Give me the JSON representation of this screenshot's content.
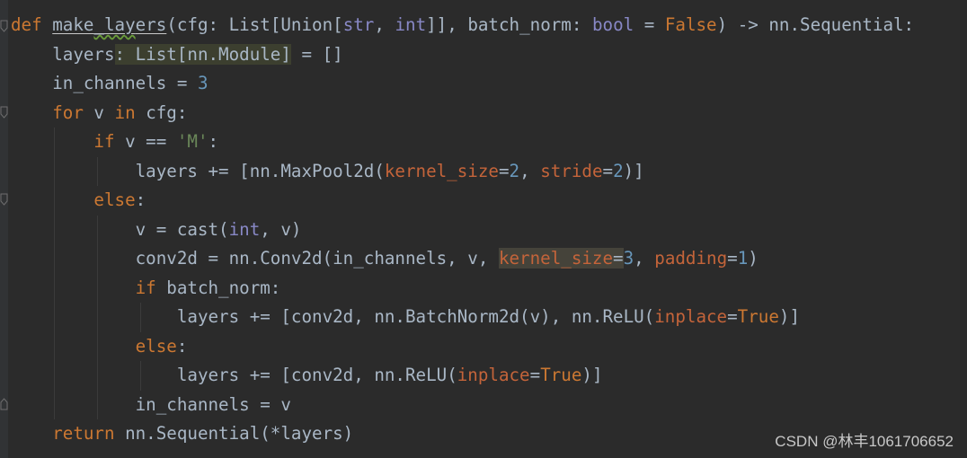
{
  "code": {
    "l1": {
      "def": "def",
      "fn_a": "make",
      "fn_sq": "_lay",
      "fn_b": "ers",
      "p1": "(cfg: List[Union[",
      "str": "str",
      "comma": ", ",
      "int": "int",
      "p2": "]], batch_norm: ",
      "bool": "bool",
      "eq": " = ",
      "false": "False",
      "p3": ") -> nn.Sequential:"
    },
    "l2": {
      "a": "layers",
      "b": ": List[nn.Module]",
      "c": " = []"
    },
    "l3": {
      "a": "in_channels = ",
      "num": "3"
    },
    "l4": {
      "for": "for",
      "a": " v ",
      "in": "in",
      "b": " cfg:"
    },
    "l5": {
      "if": "if",
      "a": " v == ",
      "str": "'M'",
      "b": ":"
    },
    "l6": {
      "a": "layers += [nn.MaxPool2d(",
      "k": "kernel_size",
      "e1": "=",
      "n1": "2",
      "c": ", ",
      "s": "stride",
      "e2": "=",
      "n2": "2",
      "b": ")]"
    },
    "l7": {
      "else": "else",
      "a": ":"
    },
    "l8": {
      "a": "v = cast(",
      "int": "int",
      "b": ", v)"
    },
    "l9": {
      "a": "conv2d = nn.Conv2d(in_channels, v, ",
      "k": "kernel_size",
      "e1": "=",
      "n1": "3",
      "c": ", ",
      "p": "padding",
      "e2": "=",
      "n2": "1",
      "b": ")"
    },
    "l10": {
      "if": "if",
      "a": " batch_norm:"
    },
    "l11": {
      "a": "layers += [conv2d, nn.BatchNorm2d(v), nn.ReLU(",
      "p": "inplace",
      "e": "=",
      "t": "True",
      "b": ")]"
    },
    "l12": {
      "else": "else",
      "a": ":"
    },
    "l13": {
      "a": "layers += [conv2d, nn.ReLU(",
      "p": "inplace",
      "e": "=",
      "t": "True",
      "b": ")]"
    },
    "l14": {
      "a": "in_channels = v"
    },
    "l15": {
      "ret": "return",
      "a": " nn.Sequential(*layers)"
    }
  },
  "watermark": "CSDN @林丰1061706652",
  "colors": {
    "background": "#2b2b2b",
    "keyword": "#cc7832",
    "text": "#a9b7c6",
    "number": "#6897bb",
    "string": "#6a8759",
    "param": "#aa4926",
    "builtin": "#8888c6"
  }
}
